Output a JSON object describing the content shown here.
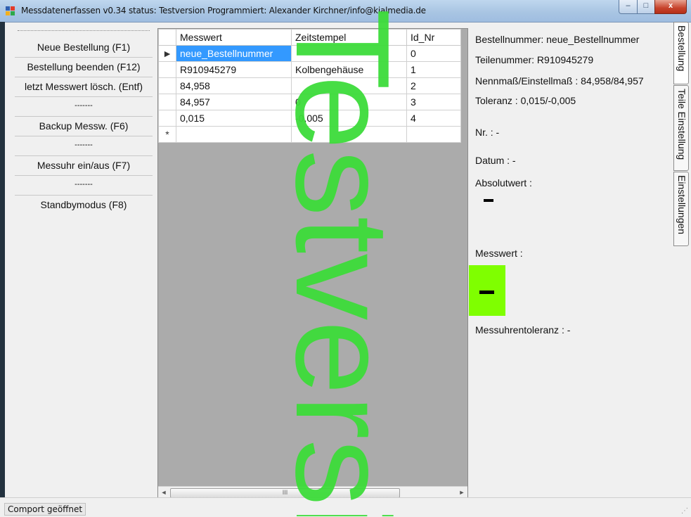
{
  "window": {
    "title": "Messdatenerfassen  v0.34  status: Testversion  Programmiert: Alexander Kirchner/info@kialmedia.de",
    "controls": {
      "minimize": "–",
      "maximize": "□",
      "close": "x"
    }
  },
  "menu": {
    "items": [
      {
        "label": "Neue Bestellung (F1)"
      },
      {
        "label": "Bestellung beenden (F12)"
      },
      {
        "label": "letzt Messwert lösch. (Entf)"
      },
      {
        "separator": "-------"
      },
      {
        "label": "Backup Messw. (F6)"
      },
      {
        "separator": "-------"
      },
      {
        "label": "Messuhr ein/aus (F7)"
      },
      {
        "separator": "-------"
      },
      {
        "label": "Standbymodus (F8)"
      }
    ]
  },
  "grid": {
    "columns": [
      "Messwert",
      "Zeitstempel",
      "Id_Nr"
    ],
    "rows": [
      [
        "neue_Bestellnummer",
        "",
        "0"
      ],
      [
        "R910945279",
        "Kolbengehäuse",
        "1"
      ],
      [
        "84,958",
        "",
        "2"
      ],
      [
        "84,957",
        "0",
        "3"
      ],
      [
        "0,015",
        "-0,005",
        "4"
      ]
    ],
    "current_row_marker": "►",
    "new_row_marker": "*",
    "scroll_thumb": "III"
  },
  "info": {
    "bestellnummer": "Bestellnummer:  neue_Bestellnummer",
    "teilenummer": "Teilenummer:  R910945279",
    "nennmass": "Nennmaß/Einstellmaß :  84,958/84,957",
    "toleranz": "Toleranz :  0,015/-0,005",
    "nr": "Nr. :  -",
    "datum": "Datum :  -",
    "absolutwert": "Absolutwert :",
    "messwert": "Messwert :",
    "messuhrentoleranz": "Messuhrentoleranz :  -",
    "messwert_box_color": "#7fff00"
  },
  "tabs": [
    {
      "label": "Bestellung",
      "active": true
    },
    {
      "label": "Teile Einstellung",
      "active": false
    },
    {
      "label": "Einstellungen",
      "active": false
    }
  ],
  "status": {
    "text": "Comport geöffnet"
  },
  "watermark": {
    "text": "Testversion",
    "color": "#3ddc3a"
  }
}
